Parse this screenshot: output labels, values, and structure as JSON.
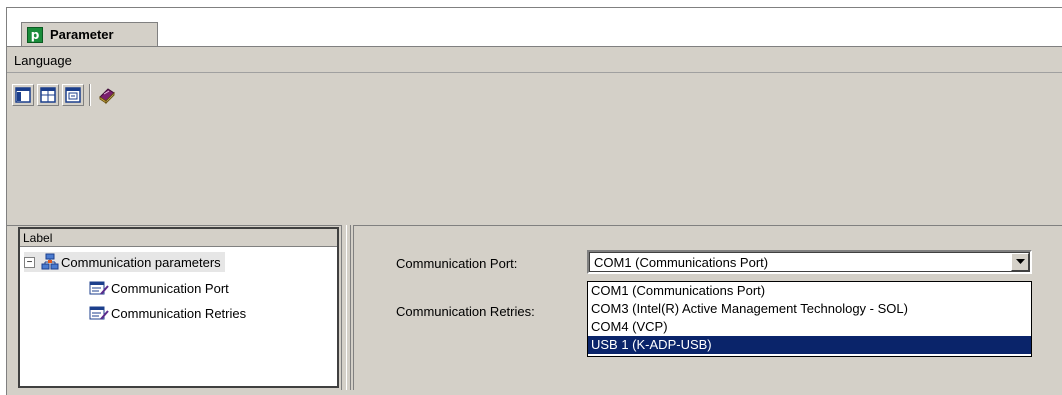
{
  "window": {
    "tab_title": "Parameter",
    "logo_text": "p"
  },
  "menu": {
    "items": [
      "Language"
    ]
  },
  "toolbar": {
    "buttons": [
      "layout-left-icon",
      "layout-grid-icon",
      "layout-detail-icon",
      "help-book-icon"
    ]
  },
  "tree": {
    "header": "Label",
    "root": {
      "label": "Communication parameters",
      "expander": "−",
      "expanded": true
    },
    "children": [
      {
        "label": "Communication Port"
      },
      {
        "label": "Communication Retries"
      }
    ]
  },
  "form": {
    "port_label": "Communication Port:",
    "retries_label": "Communication Retries:",
    "port_value": "COM1 (Communications Port)",
    "port_options": [
      {
        "label": "COM1 (Communications Port)",
        "selected": false
      },
      {
        "label": "COM3 (Intel(R) Active Management Technology - SOL)",
        "selected": false
      },
      {
        "label": "COM4 (VCP)",
        "selected": false
      },
      {
        "label": "USB 1 (K-ADP-USB)",
        "selected": true
      }
    ]
  },
  "colors": {
    "window_bg": "#d4d0c8",
    "selection_bg": "#0a246a",
    "logo_green": "#1a8c3a"
  }
}
